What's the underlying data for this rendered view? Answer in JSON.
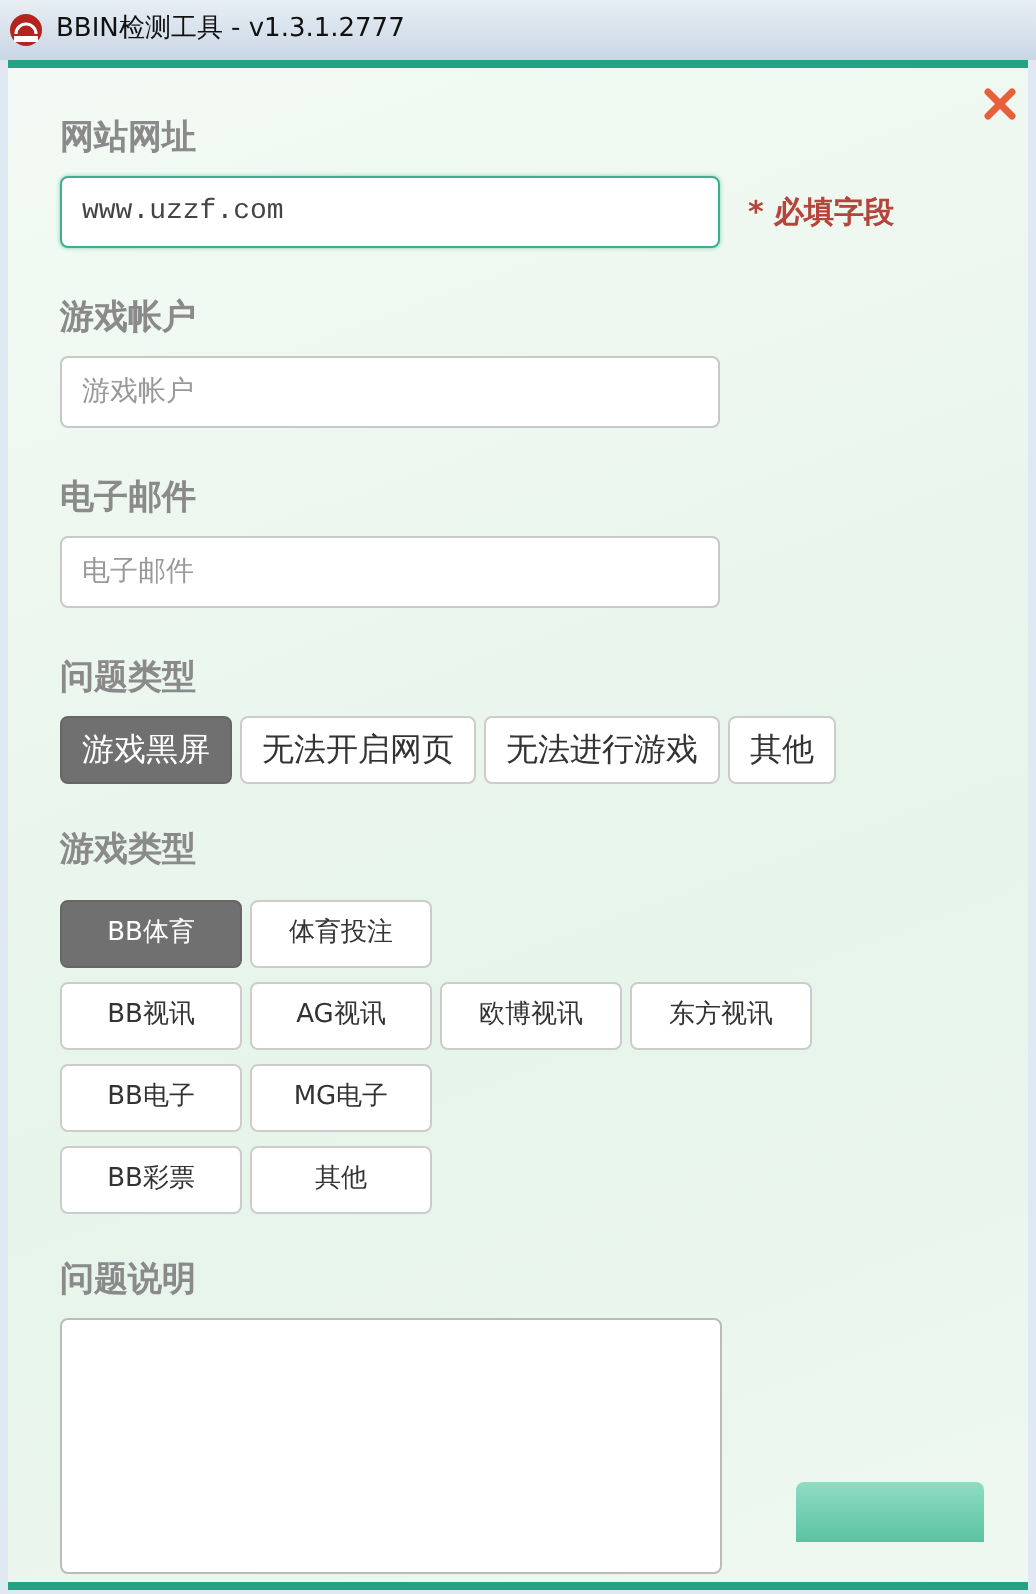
{
  "window": {
    "title": "BBIN检测工具 - v1.3.1.2777"
  },
  "fields": [
    {
      "label": "网站网址",
      "value": "www.uzzf.com",
      "focused": true,
      "required_note": "* 必填字段"
    },
    {
      "label": "游戏帐户",
      "placeholder": "游戏帐户",
      "focused": false
    },
    {
      "label": "电子邮件",
      "placeholder": "电子邮件",
      "focused": false
    }
  ],
  "problem_type": {
    "label": "问题类型",
    "options": [
      {
        "label": "游戏黑屏",
        "selected": true
      },
      {
        "label": "无法开启网页",
        "selected": false
      },
      {
        "label": "无法进行游戏",
        "selected": false
      },
      {
        "label": "其他",
        "selected": false
      }
    ]
  },
  "game_type": {
    "label": "游戏类型",
    "rows": [
      {
        "options": [
          {
            "label": "BB体育",
            "selected": true
          },
          {
            "label": "体育投注",
            "selected": false
          }
        ]
      },
      {
        "options": [
          {
            "label": "BB视讯",
            "selected": false
          },
          {
            "label": "AG视讯",
            "selected": false
          },
          {
            "label": "欧博视讯",
            "selected": false
          },
          {
            "label": "东方视讯",
            "selected": false
          }
        ]
      },
      {
        "options": [
          {
            "label": "BB电子",
            "selected": false
          },
          {
            "label": "MG电子",
            "selected": false
          }
        ]
      },
      {
        "options": [
          {
            "label": "BB彩票",
            "selected": false
          },
          {
            "label": "其他",
            "selected": false
          }
        ]
      }
    ]
  },
  "description": {
    "label": "问题说明"
  }
}
